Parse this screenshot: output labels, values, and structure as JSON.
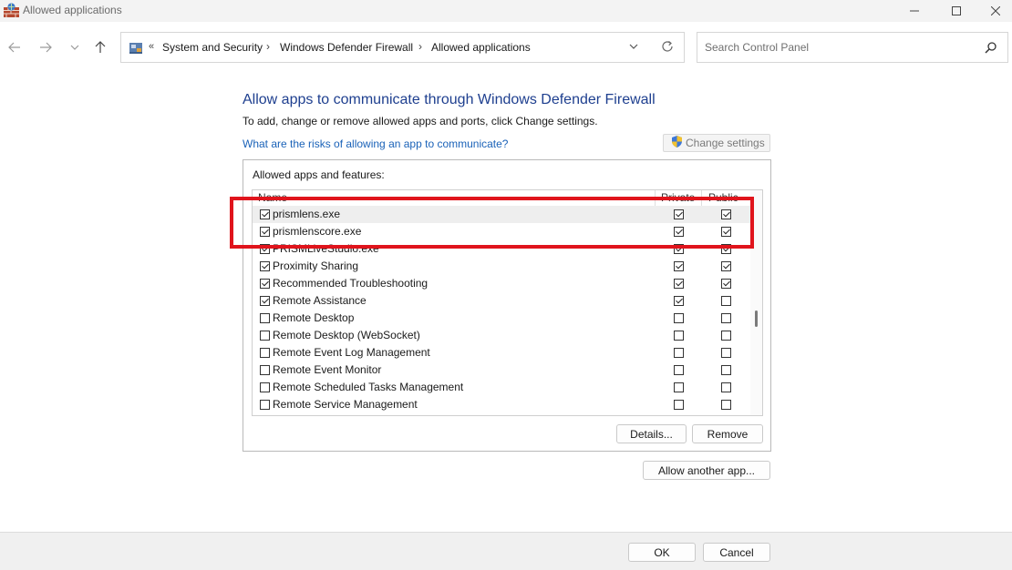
{
  "window": {
    "title": "Allowed applications"
  },
  "address": {
    "prefix": "«",
    "crumbs": [
      "System and Security",
      "Windows Defender Firewall",
      "Allowed applications"
    ],
    "separator": "›"
  },
  "search": {
    "placeholder": "Search Control Panel"
  },
  "main": {
    "title": "Allow apps to communicate through Windows Defender Firewall",
    "subtitle": "To add, change or remove allowed apps and ports, click Change settings.",
    "risk_link": "What are the risks of allowing an app to communicate?",
    "change_settings": "Change settings"
  },
  "group": {
    "label": "Allowed apps and features:",
    "columns": {
      "name": "Name",
      "private": "Private",
      "public": "Public"
    },
    "rows": [
      {
        "name": "prismlens.exe",
        "enabled": true,
        "private": true,
        "public": true
      },
      {
        "name": "prismlenscore.exe",
        "enabled": true,
        "private": true,
        "public": true
      },
      {
        "name": "PRISMLiveStudio.exe",
        "enabled": true,
        "private": true,
        "public": true
      },
      {
        "name": "Proximity Sharing",
        "enabled": true,
        "private": true,
        "public": true
      },
      {
        "name": "Recommended Troubleshooting",
        "enabled": true,
        "private": true,
        "public": true
      },
      {
        "name": "Remote Assistance",
        "enabled": true,
        "private": true,
        "public": false
      },
      {
        "name": "Remote Desktop",
        "enabled": false,
        "private": false,
        "public": false
      },
      {
        "name": "Remote Desktop (WebSocket)",
        "enabled": false,
        "private": false,
        "public": false
      },
      {
        "name": "Remote Event Log Management",
        "enabled": false,
        "private": false,
        "public": false
      },
      {
        "name": "Remote Event Monitor",
        "enabled": false,
        "private": false,
        "public": false
      },
      {
        "name": "Remote Scheduled Tasks Management",
        "enabled": false,
        "private": false,
        "public": false
      },
      {
        "name": "Remote Service Management",
        "enabled": false,
        "private": false,
        "public": false
      }
    ],
    "details_button": "Details...",
    "remove_button": "Remove"
  },
  "allow_another_button": "Allow another app...",
  "footer": {
    "ok": "OK",
    "cancel": "Cancel"
  },
  "colors": {
    "title_blue": "#1e3f8f",
    "link_blue": "#1a62b8",
    "highlight_red": "#e0141c"
  }
}
